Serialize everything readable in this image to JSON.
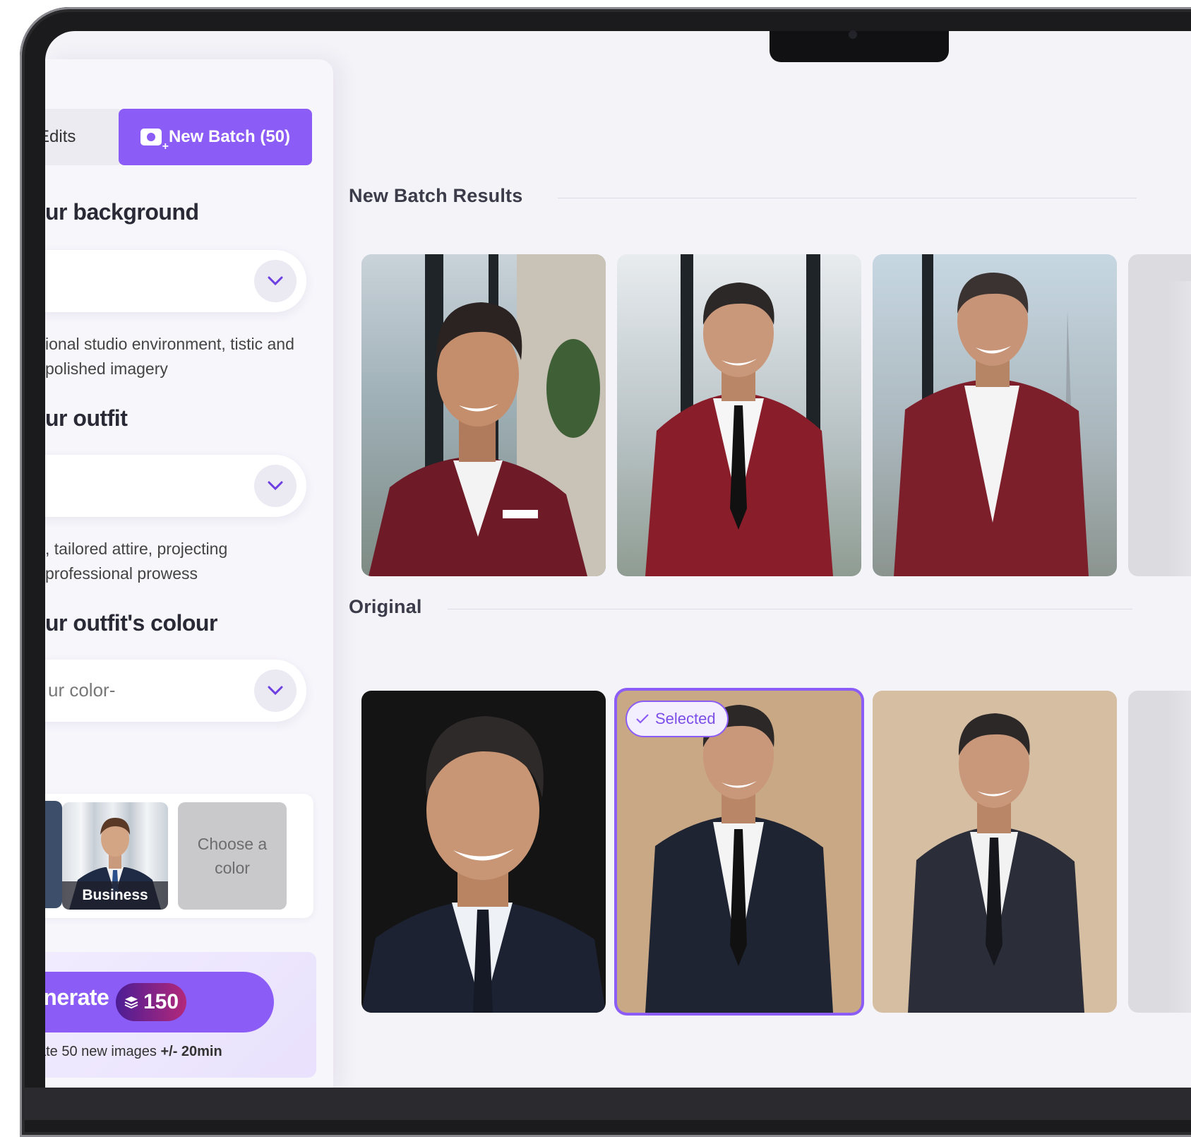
{
  "tabs": {
    "edits_label": "Edits",
    "new_batch_label": "New Batch (50)"
  },
  "form": {
    "background": {
      "heading": "ur background",
      "description": "ional studio environment, tistic and polished imagery"
    },
    "outfit": {
      "heading": "ur outfit",
      "description": ", tailored attire, projecting professional prowess"
    },
    "outfit_colour": {
      "heading": "ur outfit's colour",
      "placeholder": "ur color-"
    },
    "presets": {
      "business_label": "Business",
      "choose_color_label": "Choose a color"
    }
  },
  "generate": {
    "label": "enerate",
    "credits": "150",
    "note_prefix": "ate 50 new images",
    "note_time": "+/- 20min"
  },
  "results": {
    "new_batch_title": "New Batch Results",
    "original_title": "Original",
    "selected_label": "Selected"
  },
  "colors": {
    "accent": "#8b5cf6",
    "suit_burgundy": "#7a1f2b",
    "suit_navy": "#1f2433"
  },
  "icons": [
    "camera-plus-icon",
    "chevron-down-icon",
    "check-icon",
    "layers-icon"
  ]
}
